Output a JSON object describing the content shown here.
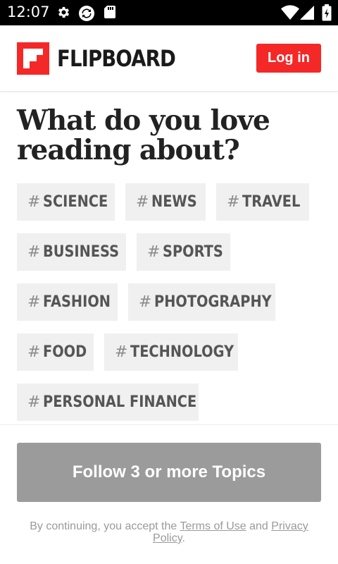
{
  "status_bar": {
    "time": "12:07",
    "icons": [
      "gear-icon",
      "sync-icon",
      "sd-card-icon",
      "wifi-icon",
      "signal-icon",
      "battery-icon"
    ]
  },
  "header": {
    "logo_text": "FLIPBOARD",
    "login_label": "Log in",
    "brand_color": "#f52828"
  },
  "main": {
    "heading_line1": "What do you love",
    "heading_line2": "reading about?",
    "topics": [
      {
        "hash": "#",
        "label": "SCIENCE"
      },
      {
        "hash": "#",
        "label": "NEWS"
      },
      {
        "hash": "#",
        "label": "TRAVEL"
      },
      {
        "hash": "#",
        "label": "BUSINESS"
      },
      {
        "hash": "#",
        "label": "SPORTS"
      },
      {
        "hash": "#",
        "label": "FASHION"
      },
      {
        "hash": "#",
        "label": "PHOTOGRAPHY"
      },
      {
        "hash": "#",
        "label": "FOOD"
      },
      {
        "hash": "#",
        "label": "TECHNOLOGY"
      },
      {
        "hash": "#",
        "label": "PERSONAL FINANCE"
      }
    ]
  },
  "footer": {
    "follow_label": "Follow 3 or more Topics",
    "legal_prefix": "By continuing, you accept the ",
    "terms_link": "Terms of Use",
    "legal_and": " and ",
    "privacy_link": "Privacy Policy",
    "legal_suffix": "."
  }
}
